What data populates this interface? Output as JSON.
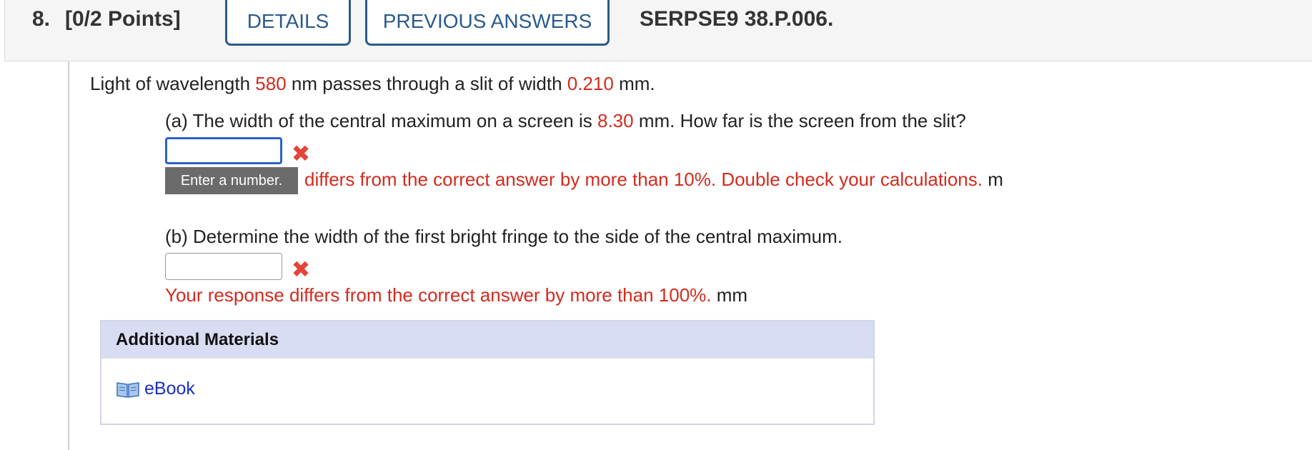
{
  "header": {
    "question_number": "8.",
    "points": "[0/2 Points]",
    "details_label": "DETAILS",
    "previous_answers_label": "PREVIOUS ANSWERS",
    "question_code": "SERPSE9 38.P.006."
  },
  "problem": {
    "stem_prefix": "Light of wavelength ",
    "wavelength": "580",
    "stem_mid": " nm passes through a slit of width ",
    "slit_width": "0.210",
    "stem_suffix": " mm."
  },
  "part_a": {
    "prefix": "(a) The width of the central maximum on a screen is ",
    "value": "8.30",
    "suffix": " mm. How far is the screen from the slit?",
    "input_value": "",
    "tooltip": "Enter a number.",
    "feedback": "differs from the correct answer by more than 10%. Double check your calculations.",
    "unit": "m"
  },
  "part_b": {
    "question": "(b) Determine the width of the first bright fringe to the side of the central maximum.",
    "input_value": "",
    "feedback": "Your response differs from the correct answer by more than 100%.",
    "unit": "mm"
  },
  "materials": {
    "title": "Additional Materials",
    "ebook_label": "eBook"
  },
  "colors": {
    "accent_blue": "#2b5a8a",
    "error_red": "#d42a1e",
    "x_mark_red": "#e4453a"
  }
}
